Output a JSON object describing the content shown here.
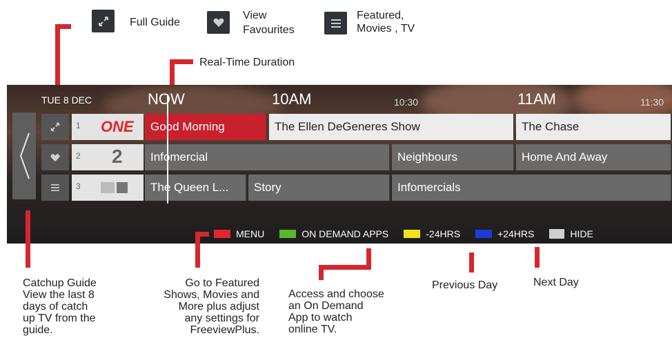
{
  "legend": {
    "full_guide": "Full Guide",
    "view_favourites_l1": "View",
    "view_favourites_l2": "Favourites",
    "featured_l1": "Featured,",
    "featured_l2": "Movies , TV"
  },
  "annotation_realtime": "Real-Time Duration",
  "guide": {
    "date": "TUE 8 DEC",
    "now": "NOW",
    "t10": "10AM",
    "t1030": "10:30",
    "t11": "11AM",
    "t1130": "11:30",
    "channels": [
      {
        "num": "1",
        "logo": "ONE"
      },
      {
        "num": "2",
        "logo": "2"
      },
      {
        "num": "3",
        "logo": ""
      }
    ],
    "row1": [
      "Good Morning",
      "The Ellen DeGeneres Show",
      "The Chase"
    ],
    "row2": [
      "Infomercial",
      "Neighbours",
      "Home And Away"
    ],
    "row3": [
      "The Queen L...",
      "Story",
      "Infomercials"
    ],
    "bottom": {
      "menu": "MENU",
      "ondemand": "ON DEMAND APPS",
      "minus": "-24HRS",
      "plus": "+24HRS",
      "hide": "HIDE"
    },
    "colors": {
      "red": "#e3262d",
      "green": "#5cb531",
      "yellow": "#f2e21e",
      "blue": "#1d3bd8"
    }
  },
  "captions": {
    "catchup": [
      "Catchup Guide",
      "View the last 8",
      "days of catch",
      "up TV from the",
      "guide."
    ],
    "featured": [
      "Go to Featured",
      "Shows, Movies and",
      "More plus adjust",
      "any settings for",
      "FreeviewPlus."
    ],
    "ondemand": [
      "Access and choose",
      "an On Demand",
      "App to watch",
      "online TV."
    ],
    "previous": "Previous Day",
    "next": "Next Day"
  }
}
